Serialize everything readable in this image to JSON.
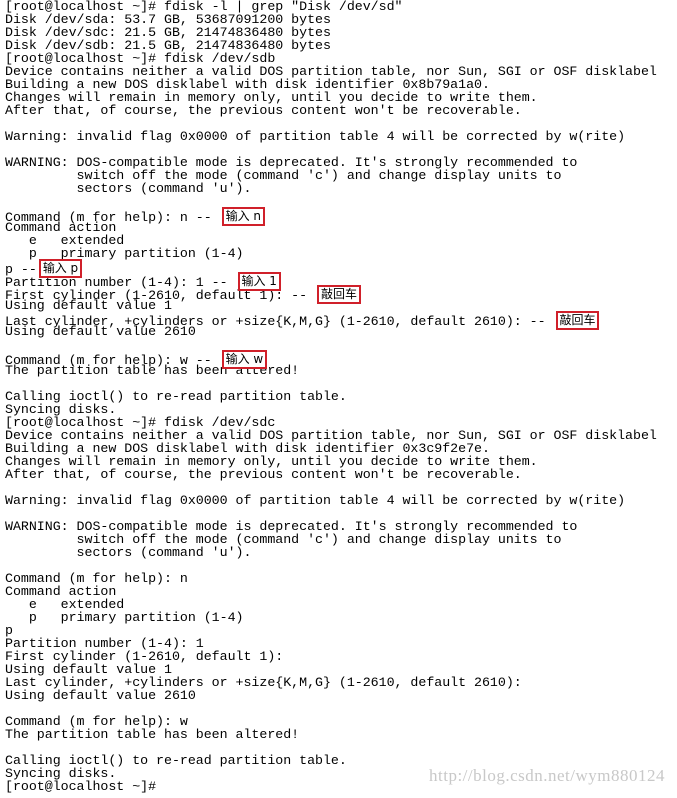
{
  "terminal": {
    "lines": [
      {
        "text": "[root@localhost ~]# fdisk -l | grep \"Disk /dev/sd\""
      },
      {
        "text": "Disk /dev/sda: 53.7 GB, 53687091200 bytes"
      },
      {
        "text": "Disk /dev/sdc: 21.5 GB, 21474836480 bytes"
      },
      {
        "text": "Disk /dev/sdb: 21.5 GB, 21474836480 bytes"
      },
      {
        "text": "[root@localhost ~]# fdisk /dev/sdb"
      },
      {
        "text": "Device contains neither a valid DOS partition table, nor Sun, SGI or OSF disklabel"
      },
      {
        "text": "Building a new DOS disklabel with disk identifier 0x8b79a1a0."
      },
      {
        "text": "Changes will remain in memory only, until you decide to write them."
      },
      {
        "text": "After that, of course, the previous content won't be recoverable."
      },
      {
        "text": ""
      },
      {
        "text": "Warning: invalid flag 0x0000 of partition table 4 will be corrected by w(rite)"
      },
      {
        "text": ""
      },
      {
        "text": "WARNING: DOS-compatible mode is deprecated. It's strongly recommended to"
      },
      {
        "text": "         switch off the mode (command 'c') and change display units to"
      },
      {
        "text": "         sectors (command 'u')."
      },
      {
        "text": ""
      },
      {
        "text": "Command (m for help): n -- ",
        "note": "输入 n"
      },
      {
        "text": "Command action"
      },
      {
        "text": "   e   extended"
      },
      {
        "text": "   p   primary partition (1-4)"
      },
      {
        "text": "p --",
        "note": "输入 p"
      },
      {
        "text": "Partition number (1-4): 1 -- ",
        "note": "输入 1"
      },
      {
        "text": "First cylinder (1-2610, default 1): -- ",
        "note": "敲回车"
      },
      {
        "text": "Using default value 1"
      },
      {
        "text": "Last cylinder, +cylinders or +size{K,M,G} (1-2610, default 2610): -- ",
        "note": "敲回车"
      },
      {
        "text": "Using default value 2610"
      },
      {
        "text": ""
      },
      {
        "text": "Command (m for help): w -- ",
        "note": "输入 w"
      },
      {
        "text": "The partition table has been altered!"
      },
      {
        "text": ""
      },
      {
        "text": "Calling ioctl() to re-read partition table."
      },
      {
        "text": "Syncing disks."
      },
      {
        "text": "[root@localhost ~]# fdisk /dev/sdc"
      },
      {
        "text": "Device contains neither a valid DOS partition table, nor Sun, SGI or OSF disklabel"
      },
      {
        "text": "Building a new DOS disklabel with disk identifier 0x3c9f2e7e."
      },
      {
        "text": "Changes will remain in memory only, until you decide to write them."
      },
      {
        "text": "After that, of course, the previous content won't be recoverable."
      },
      {
        "text": ""
      },
      {
        "text": "Warning: invalid flag 0x0000 of partition table 4 will be corrected by w(rite)"
      },
      {
        "text": ""
      },
      {
        "text": "WARNING: DOS-compatible mode is deprecated. It's strongly recommended to"
      },
      {
        "text": "         switch off the mode (command 'c') and change display units to"
      },
      {
        "text": "         sectors (command 'u')."
      },
      {
        "text": ""
      },
      {
        "text": "Command (m for help): n"
      },
      {
        "text": "Command action"
      },
      {
        "text": "   e   extended"
      },
      {
        "text": "   p   primary partition (1-4)"
      },
      {
        "text": "p"
      },
      {
        "text": "Partition number (1-4): 1"
      },
      {
        "text": "First cylinder (1-2610, default 1):"
      },
      {
        "text": "Using default value 1"
      },
      {
        "text": "Last cylinder, +cylinders or +size{K,M,G} (1-2610, default 2610):"
      },
      {
        "text": "Using default value 2610"
      },
      {
        "text": ""
      },
      {
        "text": "Command (m for help): w"
      },
      {
        "text": "The partition table has been altered!"
      },
      {
        "text": ""
      },
      {
        "text": "Calling ioctl() to re-read partition table."
      },
      {
        "text": "Syncing disks."
      },
      {
        "text": "[root@localhost ~]#"
      }
    ]
  },
  "watermark": "http://blog.csdn.net/wym880124",
  "colors": {
    "annotation_border": "#d0202a",
    "background": "#ffffff",
    "text": "#000000"
  }
}
